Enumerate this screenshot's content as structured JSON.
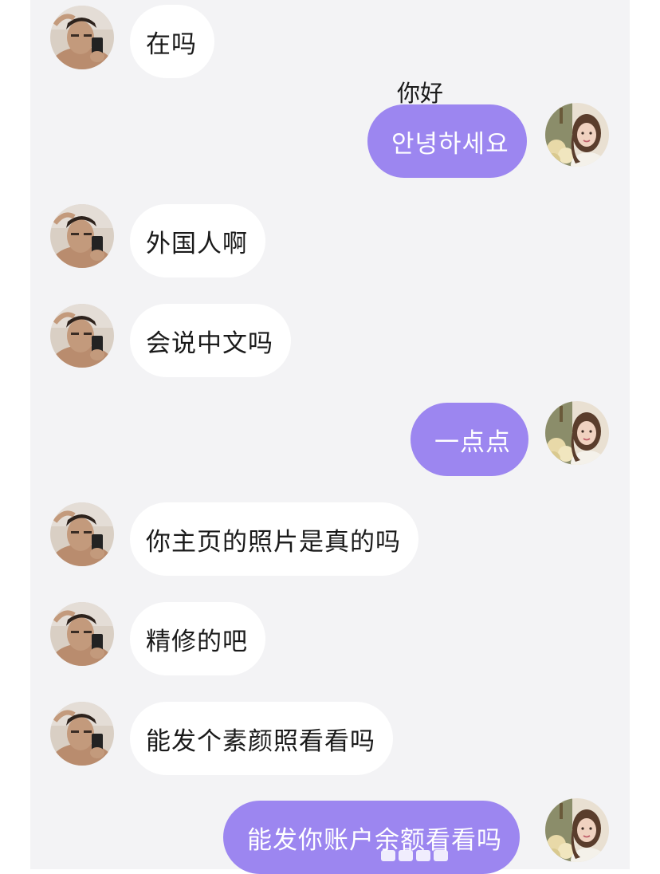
{
  "conversation": {
    "messages": [
      {
        "sender": "them",
        "text": "在吗"
      },
      {
        "sender": "me",
        "text": "안녕하세요",
        "translation": "你好"
      },
      {
        "sender": "them",
        "text": "外国人啊"
      },
      {
        "sender": "them",
        "text": "会说中文吗"
      },
      {
        "sender": "me",
        "text": "一点点"
      },
      {
        "sender": "them",
        "text": "你主页的照片是真的吗"
      },
      {
        "sender": "them",
        "text": "精修的吧"
      },
      {
        "sender": "them",
        "text": "能发个素颜照看看吗"
      },
      {
        "sender": "me",
        "text": "能发你账户余额看看吗"
      }
    ]
  },
  "colors": {
    "chat_background": "#f3f3f5",
    "incoming_bubble": "#ffffff",
    "outgoing_bubble": "#9c86f0",
    "outgoing_text": "#ffffff",
    "incoming_text": "#1a1a1a"
  },
  "icons": {
    "them_avatar": "avatar-man-selfie-icon",
    "me_avatar": "avatar-woman-portrait-icon"
  }
}
